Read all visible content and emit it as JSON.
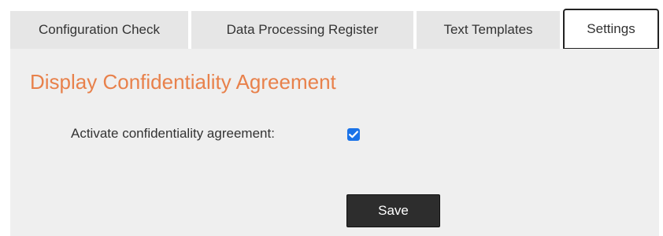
{
  "tabs": [
    {
      "label": "Configuration Check",
      "active": false
    },
    {
      "label": "Data Processing Register",
      "active": false
    },
    {
      "label": "Text Templates",
      "active": false
    },
    {
      "label": "Settings",
      "active": true
    }
  ],
  "panel": {
    "section_title": "Display Confidentiality Agreement",
    "activate_label": "Activate confidentiality agreement:",
    "activate_checked": true,
    "save_label": "Save"
  },
  "colors": {
    "title_accent": "#e8814b",
    "checkbox_blue": "#1a73e8",
    "panel_bg": "#efefef",
    "tab_bg": "#e6e6e6",
    "button_bg": "#2d2d2d"
  }
}
